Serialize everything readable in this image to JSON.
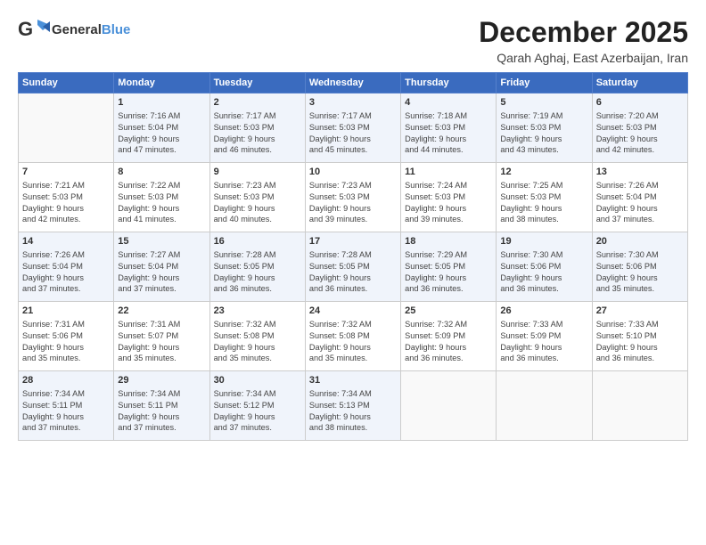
{
  "header": {
    "logo_general": "General",
    "logo_blue": "Blue",
    "month": "December 2025",
    "location": "Qarah Aghaj, East Azerbaijan, Iran"
  },
  "weekdays": [
    "Sunday",
    "Monday",
    "Tuesday",
    "Wednesday",
    "Thursday",
    "Friday",
    "Saturday"
  ],
  "weeks": [
    [
      {
        "day": "",
        "info": ""
      },
      {
        "day": "1",
        "info": "Sunrise: 7:16 AM\nSunset: 5:04 PM\nDaylight: 9 hours\nand 47 minutes."
      },
      {
        "day": "2",
        "info": "Sunrise: 7:17 AM\nSunset: 5:03 PM\nDaylight: 9 hours\nand 46 minutes."
      },
      {
        "day": "3",
        "info": "Sunrise: 7:17 AM\nSunset: 5:03 PM\nDaylight: 9 hours\nand 45 minutes."
      },
      {
        "day": "4",
        "info": "Sunrise: 7:18 AM\nSunset: 5:03 PM\nDaylight: 9 hours\nand 44 minutes."
      },
      {
        "day": "5",
        "info": "Sunrise: 7:19 AM\nSunset: 5:03 PM\nDaylight: 9 hours\nand 43 minutes."
      },
      {
        "day": "6",
        "info": "Sunrise: 7:20 AM\nSunset: 5:03 PM\nDaylight: 9 hours\nand 42 minutes."
      }
    ],
    [
      {
        "day": "7",
        "info": "Sunrise: 7:21 AM\nSunset: 5:03 PM\nDaylight: 9 hours\nand 42 minutes."
      },
      {
        "day": "8",
        "info": "Sunrise: 7:22 AM\nSunset: 5:03 PM\nDaylight: 9 hours\nand 41 minutes."
      },
      {
        "day": "9",
        "info": "Sunrise: 7:23 AM\nSunset: 5:03 PM\nDaylight: 9 hours\nand 40 minutes."
      },
      {
        "day": "10",
        "info": "Sunrise: 7:23 AM\nSunset: 5:03 PM\nDaylight: 9 hours\nand 39 minutes."
      },
      {
        "day": "11",
        "info": "Sunrise: 7:24 AM\nSunset: 5:03 PM\nDaylight: 9 hours\nand 39 minutes."
      },
      {
        "day": "12",
        "info": "Sunrise: 7:25 AM\nSunset: 5:03 PM\nDaylight: 9 hours\nand 38 minutes."
      },
      {
        "day": "13",
        "info": "Sunrise: 7:26 AM\nSunset: 5:04 PM\nDaylight: 9 hours\nand 37 minutes."
      }
    ],
    [
      {
        "day": "14",
        "info": "Sunrise: 7:26 AM\nSunset: 5:04 PM\nDaylight: 9 hours\nand 37 minutes."
      },
      {
        "day": "15",
        "info": "Sunrise: 7:27 AM\nSunset: 5:04 PM\nDaylight: 9 hours\nand 37 minutes."
      },
      {
        "day": "16",
        "info": "Sunrise: 7:28 AM\nSunset: 5:05 PM\nDaylight: 9 hours\nand 36 minutes."
      },
      {
        "day": "17",
        "info": "Sunrise: 7:28 AM\nSunset: 5:05 PM\nDaylight: 9 hours\nand 36 minutes."
      },
      {
        "day": "18",
        "info": "Sunrise: 7:29 AM\nSunset: 5:05 PM\nDaylight: 9 hours\nand 36 minutes."
      },
      {
        "day": "19",
        "info": "Sunrise: 7:30 AM\nSunset: 5:06 PM\nDaylight: 9 hours\nand 36 minutes."
      },
      {
        "day": "20",
        "info": "Sunrise: 7:30 AM\nSunset: 5:06 PM\nDaylight: 9 hours\nand 35 minutes."
      }
    ],
    [
      {
        "day": "21",
        "info": "Sunrise: 7:31 AM\nSunset: 5:06 PM\nDaylight: 9 hours\nand 35 minutes."
      },
      {
        "day": "22",
        "info": "Sunrise: 7:31 AM\nSunset: 5:07 PM\nDaylight: 9 hours\nand 35 minutes."
      },
      {
        "day": "23",
        "info": "Sunrise: 7:32 AM\nSunset: 5:08 PM\nDaylight: 9 hours\nand 35 minutes."
      },
      {
        "day": "24",
        "info": "Sunrise: 7:32 AM\nSunset: 5:08 PM\nDaylight: 9 hours\nand 35 minutes."
      },
      {
        "day": "25",
        "info": "Sunrise: 7:32 AM\nSunset: 5:09 PM\nDaylight: 9 hours\nand 36 minutes."
      },
      {
        "day": "26",
        "info": "Sunrise: 7:33 AM\nSunset: 5:09 PM\nDaylight: 9 hours\nand 36 minutes."
      },
      {
        "day": "27",
        "info": "Sunrise: 7:33 AM\nSunset: 5:10 PM\nDaylight: 9 hours\nand 36 minutes."
      }
    ],
    [
      {
        "day": "28",
        "info": "Sunrise: 7:34 AM\nSunset: 5:11 PM\nDaylight: 9 hours\nand 37 minutes."
      },
      {
        "day": "29",
        "info": "Sunrise: 7:34 AM\nSunset: 5:11 PM\nDaylight: 9 hours\nand 37 minutes."
      },
      {
        "day": "30",
        "info": "Sunrise: 7:34 AM\nSunset: 5:12 PM\nDaylight: 9 hours\nand 37 minutes."
      },
      {
        "day": "31",
        "info": "Sunrise: 7:34 AM\nSunset: 5:13 PM\nDaylight: 9 hours\nand 38 minutes."
      },
      {
        "day": "",
        "info": ""
      },
      {
        "day": "",
        "info": ""
      },
      {
        "day": "",
        "info": ""
      }
    ]
  ]
}
